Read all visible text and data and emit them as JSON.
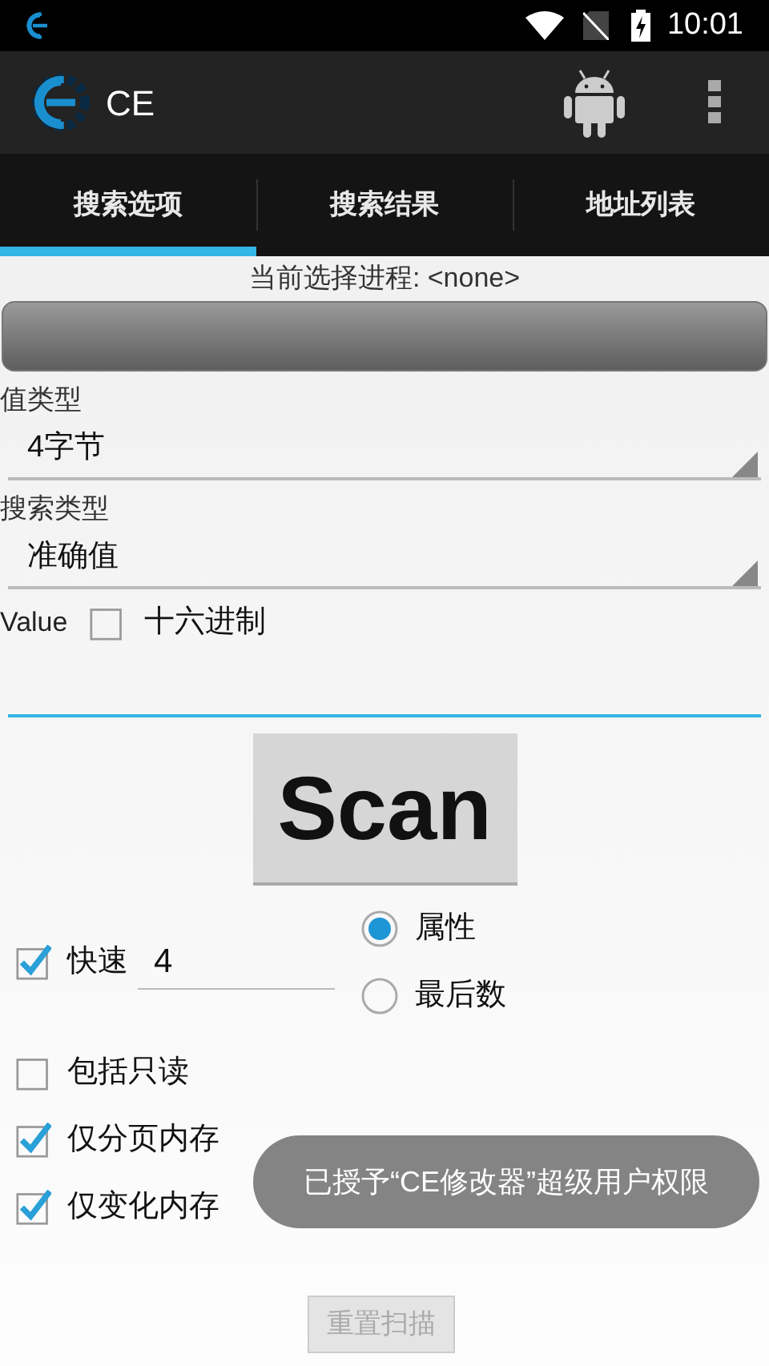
{
  "status_bar": {
    "time": "10:01"
  },
  "action_bar": {
    "title": "CE"
  },
  "tabs": [
    {
      "label": "搜索选项",
      "selected": true
    },
    {
      "label": "搜索结果",
      "selected": false
    },
    {
      "label": "地址列表",
      "selected": false
    }
  ],
  "process_label": "当前选择进程: <none>",
  "value_type": {
    "label": "值类型",
    "value": "4字节"
  },
  "search_type": {
    "label": "搜索类型",
    "value": "准确值"
  },
  "value": {
    "label": "Value",
    "hex": {
      "label": "十六进制",
      "checked": false
    }
  },
  "scan_button": "Scan",
  "fast": {
    "label": "快速",
    "checked": true,
    "value": "4"
  },
  "scan_mode": [
    {
      "label": "属性",
      "selected": true
    },
    {
      "label": "最后数",
      "selected": false
    }
  ],
  "options": [
    {
      "label": "包括只读",
      "checked": false
    },
    {
      "label": "仅分页内存",
      "checked": true
    },
    {
      "label": "仅变化内存",
      "checked": true
    }
  ],
  "toast": "已授予“CE修改器”超级用户权限",
  "reset_button": "重置扫描"
}
